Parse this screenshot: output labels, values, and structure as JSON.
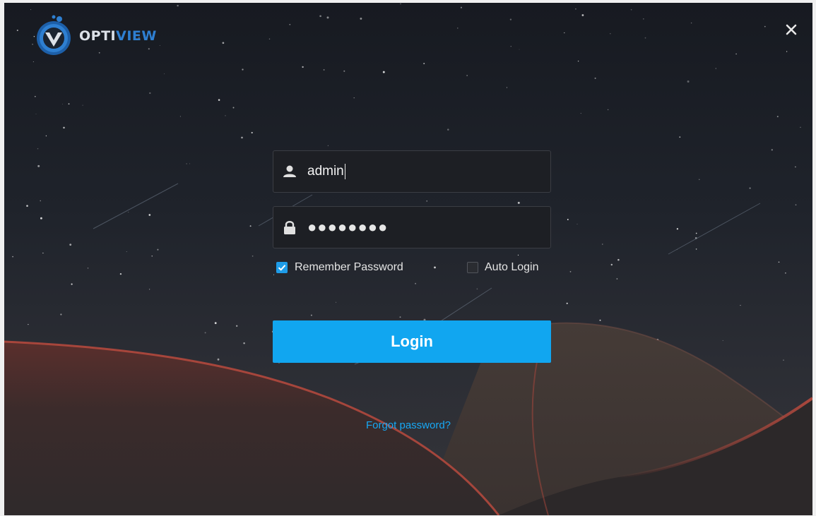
{
  "app": {
    "logo_text_a": "OPTI",
    "logo_text_b": "VIEW"
  },
  "form": {
    "username_value": "admin",
    "password_mask": "●●●●●●●●",
    "remember_password": {
      "label": "Remember Password",
      "checked": true
    },
    "auto_login": {
      "label": "Auto Login",
      "checked": false
    },
    "login_label": "Login",
    "forgot_label": "Forgot password?"
  },
  "icons": {
    "close": "close-icon",
    "user": "user-icon",
    "lock": "lock-icon",
    "check": "check-icon",
    "logo": "optiview-logo"
  },
  "colors": {
    "accent": "#11a6f0",
    "link": "#17a8f5",
    "logo_blue": "#2e7fd1",
    "dune_edge": "#b84a3e"
  }
}
